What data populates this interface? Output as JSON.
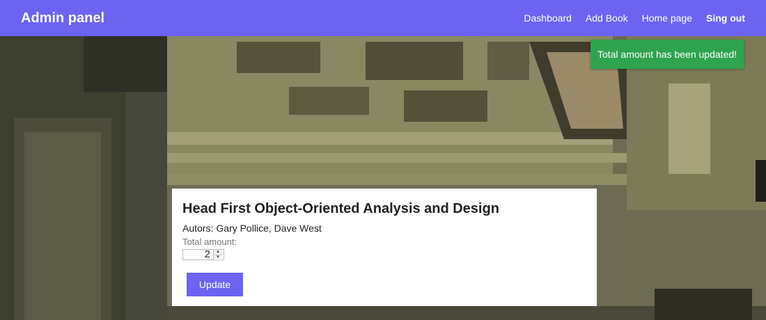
{
  "navbar": {
    "brand": "Admin panel",
    "links": [
      "Dashboard",
      "Add Book",
      "Home page"
    ],
    "signout": "Sing out"
  },
  "toast": {
    "message": "Total amount has been updated!"
  },
  "book": {
    "title": "Head First Object-Oriented Analysis and Design",
    "authors_label": "Autors:",
    "authors": "Gary Pollice, Dave West",
    "amount_label": "Total amount:",
    "amount_value": "2",
    "update_label": "Update"
  },
  "colors": {
    "accent": "#6c63f3",
    "success": "#2ea44f"
  }
}
